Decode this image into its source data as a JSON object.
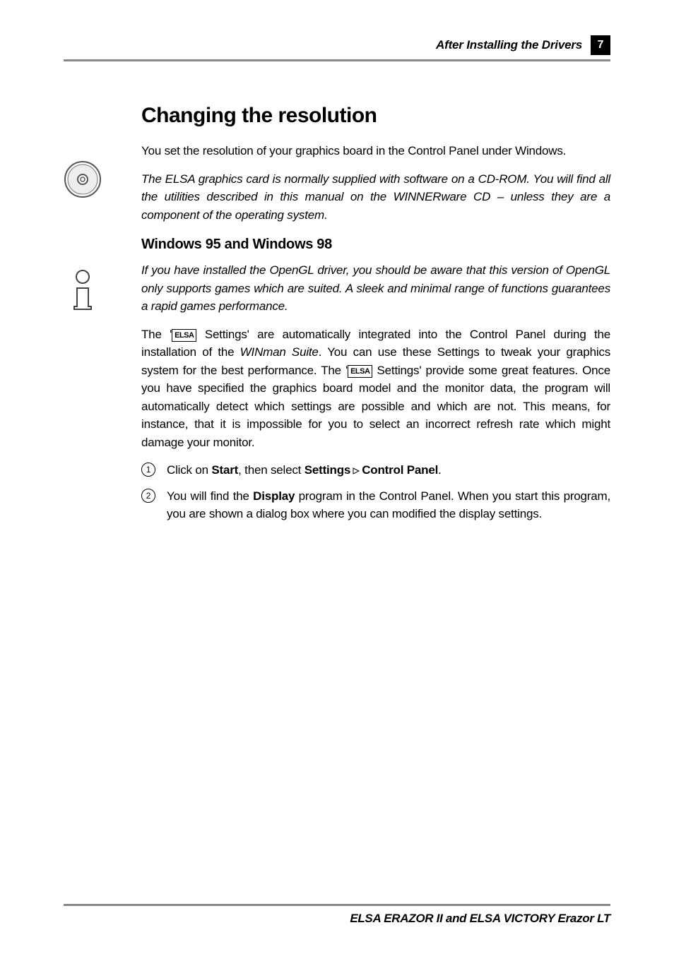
{
  "header": {
    "sectionLabel": "After Installing the Drivers",
    "pageNumber": "7"
  },
  "h1": "Changing the resolution",
  "intro": "You set the resolution of your graphics board in the Control Panel under Windows.",
  "note1": {
    "pre": "The ELSA graphics card is normally supplied with software on a CD-ROM.  You will find all the utilities described in this manual on the ",
    "product": "WINNERware CD",
    "post": " – unless they are a component of the operating system."
  },
  "h2": "Windows 95 and Windows 98",
  "note2": "If you have installed the OpenGL driver, you should be aware that this version of OpenGL only supports games which are suited.  A sleek and minimal range of functions guarantees a rapid games performance.",
  "para2": {
    "p1a": "The '",
    "elsa": "ELSA",
    "p1b": " Settings' are automatically integrated into the Control Panel during the installation of the ",
    "winman": "WINman Suite",
    "p1c": ".  You can use these Settings to tweak your graphics system for the best performance.  The '",
    "p1d": " Settings' provide some great features.  Once you have specified the graphics board model and the monitor data, the program will automatically detect which settings are possible and which are not.  This means, for instance, that it is impossible for you to select an incorrect refresh rate which might damage your monitor."
  },
  "steps": {
    "s1": {
      "t1": "Click on ",
      "b1": "Start",
      "t2": ", then select ",
      "b2": "Settings",
      "t3": " ",
      "b3": "Control Panel",
      "t4": "."
    },
    "s2": {
      "t1": "You will find the ",
      "b1": "Display",
      "t2": " program in the Control Panel.  When you start this program, you are shown a dialog box where you can modified the display settings."
    }
  },
  "footer": "ELSA ERAZOR II and ELSA VICTORY Erazor LT"
}
